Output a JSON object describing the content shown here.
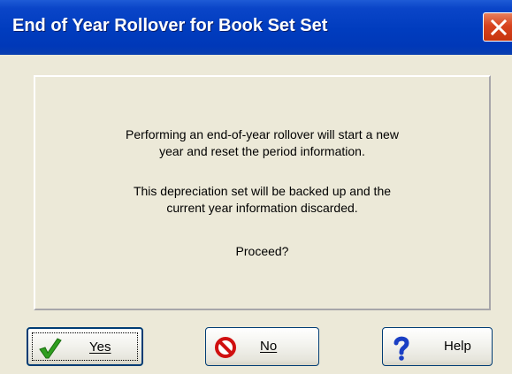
{
  "window": {
    "title": "End of Year Rollover for Book Set Set"
  },
  "message": {
    "line1": "Performing an end-of-year rollover will start a new",
    "line2": "year and reset the period information.",
    "line3": "This depreciation set will be backed up and the",
    "line4": "current year information discarded.",
    "line5": "Proceed?"
  },
  "buttons": {
    "yes": {
      "label": "Yes",
      "icon": "checkmark-icon"
    },
    "no": {
      "label": "No",
      "icon": "no-entry-icon"
    },
    "help": {
      "label": "Help",
      "icon": "question-mark-icon"
    }
  },
  "colors": {
    "titlebar": "#003cbe",
    "close": "#d8431f",
    "dialog_bg": "#ece9d8",
    "check_green": "#2f9e1f",
    "no_red": "#d01010",
    "help_blue": "#1a3fc4"
  }
}
